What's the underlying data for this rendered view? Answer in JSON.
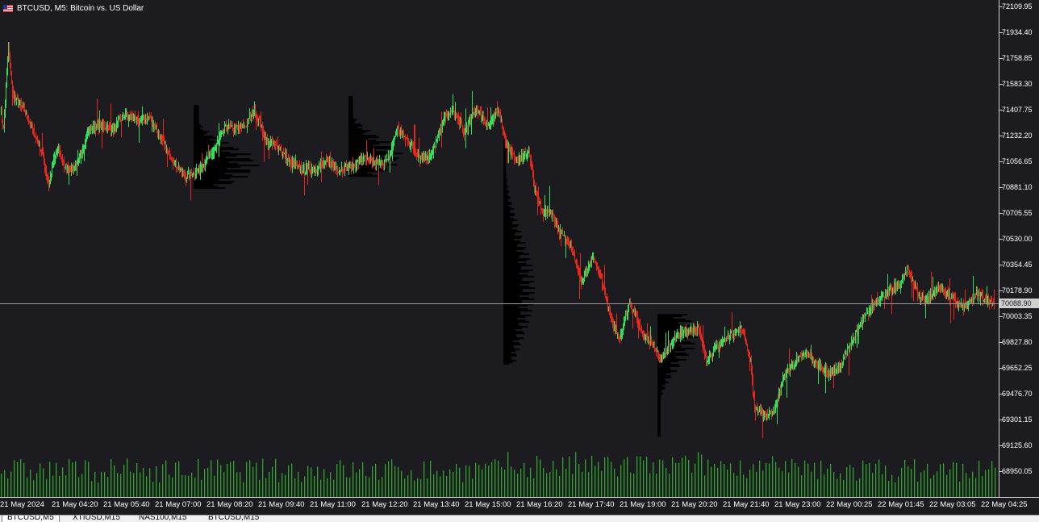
{
  "window": {
    "title": "BTCUSD, M5:  Bitcoin vs. US Dollar",
    "flag_icon": "us-flag-icon"
  },
  "colors": {
    "background": "#1c1b20",
    "bull": "#2ee25e",
    "bear": "#e8261c",
    "volume": "#2ea52e",
    "volume_profile": "#000000",
    "axis": "#cfcfcf"
  },
  "price_scale": {
    "labels": [
      "72109.95",
      "71934.40",
      "71758.85",
      "71583.30",
      "71407.75",
      "71232.20",
      "71056.65",
      "70881.10",
      "70705.55",
      "70530.00",
      "70354.45",
      "70178.90",
      "70003.35",
      "69827.80",
      "69652.25",
      "69476.70",
      "69301.15",
      "69125.60",
      "68950.05"
    ],
    "current_price": "70088.90"
  },
  "time_scale": {
    "labels": [
      "21 May 2024",
      "21 May 04:20",
      "21 May 05:40",
      "21 May 07:00",
      "21 May 08:20",
      "21 May 09:40",
      "21 May 11:00",
      "21 May 12:20",
      "21 May 13:40",
      "21 May 15:00",
      "21 May 16:20",
      "21 May 17:40",
      "21 May 19:00",
      "21 May 20:20",
      "21 May 21:40",
      "21 May 23:00",
      "22 May 00:25",
      "22 May 01:45",
      "22 May 03:05",
      "22 May 04:25"
    ]
  },
  "tabs": [
    {
      "label": "BTCUSD,M5",
      "active": true
    },
    {
      "label": "XTIUSD,M15",
      "active": false
    },
    {
      "label": "NAS100,M15",
      "active": false
    },
    {
      "label": "BTCUSD,M15",
      "active": false
    }
  ],
  "chart_data": {
    "type": "candlestick",
    "symbol": "BTCUSD",
    "timeframe": "M5",
    "ylim": [
      68900,
      72120
    ],
    "path_anchors": [
      {
        "t": 0,
        "p": 71420
      },
      {
        "t": 4,
        "p": 71280
      },
      {
        "t": 10,
        "p": 71820
      },
      {
        "t": 16,
        "p": 71500
      },
      {
        "t": 30,
        "p": 71400
      },
      {
        "t": 44,
        "p": 71220
      },
      {
        "t": 52,
        "p": 71110
      },
      {
        "t": 60,
        "p": 70890
      },
      {
        "t": 66,
        "p": 71060
      },
      {
        "t": 72,
        "p": 71150
      },
      {
        "t": 80,
        "p": 71000
      },
      {
        "t": 95,
        "p": 71020
      },
      {
        "t": 110,
        "p": 71280
      },
      {
        "t": 124,
        "p": 71300
      },
      {
        "t": 140,
        "p": 71280
      },
      {
        "t": 155,
        "p": 71380
      },
      {
        "t": 170,
        "p": 71330
      },
      {
        "t": 185,
        "p": 71360
      },
      {
        "t": 200,
        "p": 71200
      },
      {
        "t": 215,
        "p": 71050
      },
      {
        "t": 230,
        "p": 70950
      },
      {
        "t": 245,
        "p": 71000
      },
      {
        "t": 262,
        "p": 71100
      },
      {
        "t": 280,
        "p": 71300
      },
      {
        "t": 290,
        "p": 71270
      },
      {
        "t": 305,
        "p": 71300
      },
      {
        "t": 315,
        "p": 71410
      },
      {
        "t": 330,
        "p": 71200
      },
      {
        "t": 345,
        "p": 71150
      },
      {
        "t": 360,
        "p": 71040
      },
      {
        "t": 375,
        "p": 71000
      },
      {
        "t": 390,
        "p": 71010
      },
      {
        "t": 405,
        "p": 71050
      },
      {
        "t": 420,
        "p": 71000
      },
      {
        "t": 435,
        "p": 71020
      },
      {
        "t": 450,
        "p": 71080
      },
      {
        "t": 465,
        "p": 71040
      },
      {
        "t": 480,
        "p": 71060
      },
      {
        "t": 492,
        "p": 71280
      },
      {
        "t": 505,
        "p": 71200
      },
      {
        "t": 520,
        "p": 71080
      },
      {
        "t": 535,
        "p": 71100
      },
      {
        "t": 550,
        "p": 71350
      },
      {
        "t": 562,
        "p": 71400
      },
      {
        "t": 575,
        "p": 71250
      },
      {
        "t": 590,
        "p": 71420
      },
      {
        "t": 605,
        "p": 71300
      },
      {
        "t": 618,
        "p": 71400
      },
      {
        "t": 628,
        "p": 71160
      },
      {
        "t": 640,
        "p": 71060
      },
      {
        "t": 655,
        "p": 71120
      },
      {
        "t": 662,
        "p": 70880
      },
      {
        "t": 672,
        "p": 70700
      },
      {
        "t": 682,
        "p": 70720
      },
      {
        "t": 695,
        "p": 70560
      },
      {
        "t": 708,
        "p": 70480
      },
      {
        "t": 720,
        "p": 70230
      },
      {
        "t": 735,
        "p": 70400
      },
      {
        "t": 745,
        "p": 70260
      },
      {
        "t": 758,
        "p": 69960
      },
      {
        "t": 768,
        "p": 69860
      },
      {
        "t": 780,
        "p": 70100
      },
      {
        "t": 795,
        "p": 69900
      },
      {
        "t": 810,
        "p": 69800
      },
      {
        "t": 820,
        "p": 69720
      },
      {
        "t": 835,
        "p": 69850
      },
      {
        "t": 850,
        "p": 69900
      },
      {
        "t": 865,
        "p": 69930
      },
      {
        "t": 875,
        "p": 69710
      },
      {
        "t": 890,
        "p": 69800
      },
      {
        "t": 905,
        "p": 69880
      },
      {
        "t": 920,
        "p": 69920
      },
      {
        "t": 930,
        "p": 69700
      },
      {
        "t": 935,
        "p": 69380
      },
      {
        "t": 948,
        "p": 69330
      },
      {
        "t": 960,
        "p": 69360
      },
      {
        "t": 970,
        "p": 69580
      },
      {
        "t": 985,
        "p": 69700
      },
      {
        "t": 1000,
        "p": 69750
      },
      {
        "t": 1012,
        "p": 69680
      },
      {
        "t": 1025,
        "p": 69620
      },
      {
        "t": 1040,
        "p": 69650
      },
      {
        "t": 1055,
        "p": 69830
      },
      {
        "t": 1070,
        "p": 69980
      },
      {
        "t": 1085,
        "p": 70100
      },
      {
        "t": 1100,
        "p": 70170
      },
      {
        "t": 1115,
        "p": 70220
      },
      {
        "t": 1125,
        "p": 70330
      },
      {
        "t": 1140,
        "p": 70120
      },
      {
        "t": 1152,
        "p": 70130
      },
      {
        "t": 1165,
        "p": 70210
      },
      {
        "t": 1180,
        "p": 70120
      },
      {
        "t": 1195,
        "p": 70060
      },
      {
        "t": 1210,
        "p": 70150
      },
      {
        "t": 1232,
        "p": 70090
      }
    ],
    "volume_profiles": [
      {
        "start_t": 240,
        "top": 71440,
        "bottom": 70880,
        "peak_price": 71040,
        "max_width_t": 82
      },
      {
        "start_t": 432,
        "top": 71500,
        "bottom": 70960,
        "peak_price": 71100,
        "max_width_t": 68
      },
      {
        "start_t": 624,
        "top": 71210,
        "bottom": 69680,
        "peak_price": 70200,
        "max_width_t": 40
      },
      {
        "start_t": 815,
        "top": 70020,
        "bottom": 69190,
        "peak_price": 69870,
        "max_width_t": 50
      }
    ]
  }
}
